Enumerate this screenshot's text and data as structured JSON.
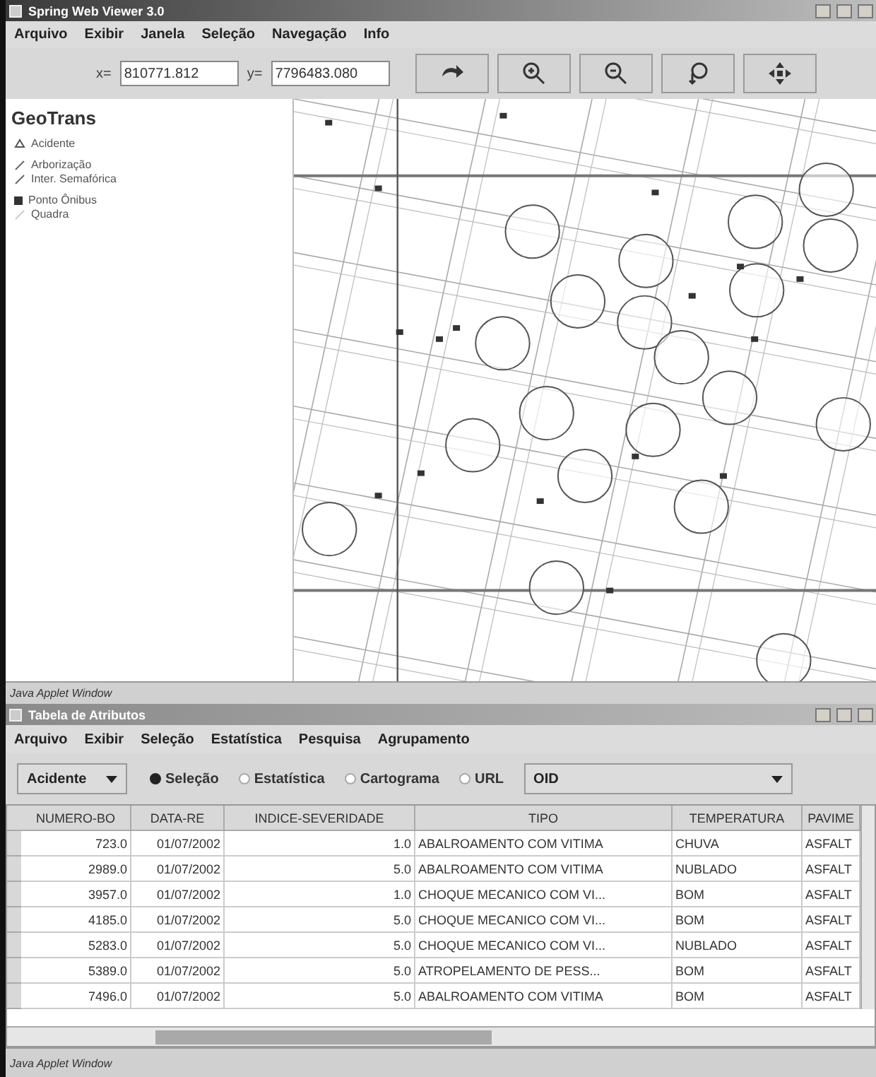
{
  "viewer_window": {
    "title": "Spring Web Viewer 3.0",
    "menu": [
      "Arquivo",
      "Exibir",
      "Janela",
      "Seleção",
      "Navegação",
      "Info"
    ],
    "coords": {
      "x_label": "x=",
      "x_value": "810771.812",
      "y_label": "y=",
      "y_value": "7796483.080"
    },
    "tools": [
      {
        "kind": "redo"
      },
      {
        "kind": "zoom_in"
      },
      {
        "kind": "zoom_out"
      },
      {
        "kind": "pan"
      },
      {
        "kind": "move"
      }
    ],
    "legend": {
      "title": "GeoTrans",
      "groups": [
        [
          {
            "label": "Acidente",
            "kind": "triangle"
          }
        ],
        [
          {
            "label": "Arborização",
            "kind": "line"
          },
          {
            "label": "Inter. Semafórica",
            "kind": "line"
          }
        ],
        [
          {
            "label": "Ponto Ônibus",
            "kind": "square"
          },
          {
            "label": "Quadra",
            "kind": "faint_line"
          }
        ]
      ]
    },
    "status": "Java Applet Window"
  },
  "table_window": {
    "title": "Tabela de Atributos",
    "menu": [
      "Arquivo",
      "Exibir",
      "Seleção",
      "Estatística",
      "Pesquisa",
      "Agrupamento"
    ],
    "layer_select": "Acidente",
    "modes": [
      {
        "label": "Seleção",
        "selected": true
      },
      {
        "label": "Estatística",
        "selected": false
      },
      {
        "label": "Cartograma",
        "selected": false
      },
      {
        "label": "URL",
        "selected": false
      }
    ],
    "field_select": "OID",
    "table": {
      "columns": [
        "NUMERO-BO",
        "DATA-RE",
        "INDICE-SEVERIDADE",
        "TIPO",
        "TEMPERATURA",
        "PAVIME"
      ],
      "rows": [
        [
          "723.0",
          "01/07/2002",
          "1.0",
          "ABALROAMENTO COM VITIMA",
          "CHUVA",
          "ASFALT"
        ],
        [
          "2989.0",
          "01/07/2002",
          "5.0",
          "ABALROAMENTO COM VITIMA",
          "NUBLADO",
          "ASFALT"
        ],
        [
          "3957.0",
          "01/07/2002",
          "1.0",
          "CHOQUE MECANICO COM VI...",
          "BOM",
          "ASFALT"
        ],
        [
          "4185.0",
          "01/07/2002",
          "5.0",
          "CHOQUE MECANICO COM VI...",
          "BOM",
          "ASFALT"
        ],
        [
          "5283.0",
          "01/07/2002",
          "5.0",
          "CHOQUE MECANICO COM VI...",
          "NUBLADO",
          "ASFALT"
        ],
        [
          "5389.0",
          "01/07/2002",
          "5.0",
          "ATROPELAMENTO DE PESS...",
          "BOM",
          "ASFALT"
        ],
        [
          "7496.0",
          "01/07/2002",
          "5.0",
          "ABALROAMENTO COM VITIMA",
          "BOM",
          "ASFALT"
        ]
      ]
    },
    "status": "Java Applet Window"
  }
}
